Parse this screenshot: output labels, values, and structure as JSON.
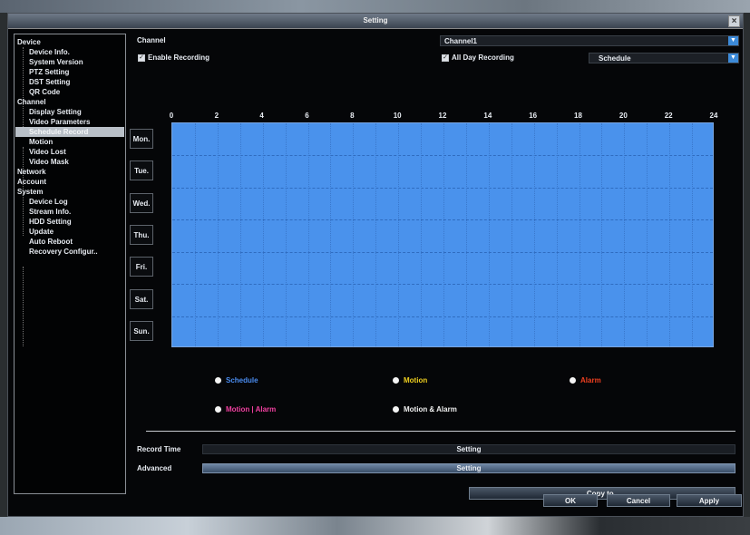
{
  "window": {
    "title": "Setting",
    "close_icon": "×"
  },
  "sidebar": {
    "items": [
      {
        "label": "Device",
        "level": 1
      },
      {
        "label": "Device Info.",
        "level": 2
      },
      {
        "label": "System Version",
        "level": 2
      },
      {
        "label": "PTZ Setting",
        "level": 2
      },
      {
        "label": "DST Setting",
        "level": 2
      },
      {
        "label": "QR Code",
        "level": 2
      },
      {
        "label": "Channel",
        "level": 1
      },
      {
        "label": "Display Setting",
        "level": 2
      },
      {
        "label": "Video Parameters",
        "level": 2
      },
      {
        "label": "Schedule Record",
        "level": 2,
        "selected": true
      },
      {
        "label": "Motion",
        "level": 2
      },
      {
        "label": "Video Lost",
        "level": 2
      },
      {
        "label": "Video Mask",
        "level": 2
      },
      {
        "label": "Network",
        "level": 1
      },
      {
        "label": "Account",
        "level": 1
      },
      {
        "label": "System",
        "level": 1
      },
      {
        "label": "Device Log",
        "level": 2
      },
      {
        "label": "Stream Info.",
        "level": 2
      },
      {
        "label": "HDD Setting",
        "level": 2
      },
      {
        "label": "Update",
        "level": 2
      },
      {
        "label": "Auto Reboot",
        "level": 2
      },
      {
        "label": "Recovery Configur..",
        "level": 2
      }
    ]
  },
  "form": {
    "channel_label": "Channel",
    "channel_value": "Channel1",
    "enable_recording_label": "Enable Recording",
    "enable_recording_checked": true,
    "all_day_label": "All Day Recording",
    "all_day_checked": true,
    "mode_value": "Schedule"
  },
  "schedule": {
    "hours": [
      "0",
      "2",
      "4",
      "6",
      "8",
      "10",
      "12",
      "14",
      "16",
      "18",
      "20",
      "22",
      "24"
    ],
    "days": [
      "Mon.",
      "Tue.",
      "Wed.",
      "Thu.",
      "Fri.",
      "Sat.",
      "Sun."
    ],
    "fill_color": "#4a92ec",
    "fill_type": "Schedule",
    "fill_fraction": 1.0
  },
  "legend": [
    {
      "label": "Schedule",
      "color": "#4a8cf0"
    },
    {
      "label": "Motion",
      "color": "#f0d020"
    },
    {
      "label": "Alarm",
      "color": "#f04020"
    },
    {
      "label": "Motion | Alarm",
      "color": "#f040a0"
    },
    {
      "label": "Motion & Alarm",
      "color": "#f0f0f0"
    }
  ],
  "record_time": {
    "label": "Record Time",
    "button": "Setting"
  },
  "advanced": {
    "label": "Advanced",
    "button": "Setting"
  },
  "buttons": {
    "copy_to": "Copy to..",
    "ok": "OK",
    "cancel": "Cancel",
    "apply": "Apply"
  }
}
